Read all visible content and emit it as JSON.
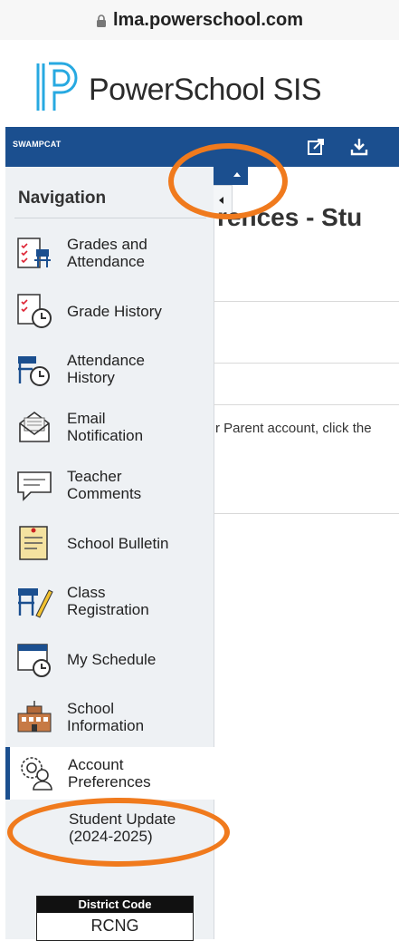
{
  "browser": {
    "url": "lma.powerschool.com"
  },
  "brand": {
    "name": "PowerSchool SIS"
  },
  "topbar": {
    "district_tag": "SWAMPCAT"
  },
  "navigation": {
    "heading": "Navigation",
    "items": [
      {
        "label": "Grades and\nAttendance",
        "icon": "grades-attendance-icon"
      },
      {
        "label": "Grade History",
        "icon": "grade-history-icon"
      },
      {
        "label": "Attendance\nHistory",
        "icon": "attendance-history-icon"
      },
      {
        "label": "Email\nNotification",
        "icon": "email-icon"
      },
      {
        "label": "Teacher\nComments",
        "icon": "comments-icon"
      },
      {
        "label": "School Bulletin",
        "icon": "bulletin-icon"
      },
      {
        "label": "Class\nRegistration",
        "icon": "class-registration-icon"
      },
      {
        "label": "My Schedule",
        "icon": "schedule-icon"
      },
      {
        "label": "School\nInformation",
        "icon": "school-icon"
      },
      {
        "label": "Account\nPreferences",
        "icon": "account-preferences-icon"
      }
    ],
    "sub_item": "Student Update\n(2024-2025)",
    "active_index": 9
  },
  "district_code": {
    "label": "District Code",
    "value": "RCNG"
  },
  "main": {
    "title": "rences - Stu",
    "body_text": "r Parent account, click the"
  },
  "colors": {
    "accent": "#1b4f8f",
    "annotation": "#f07a1d"
  }
}
